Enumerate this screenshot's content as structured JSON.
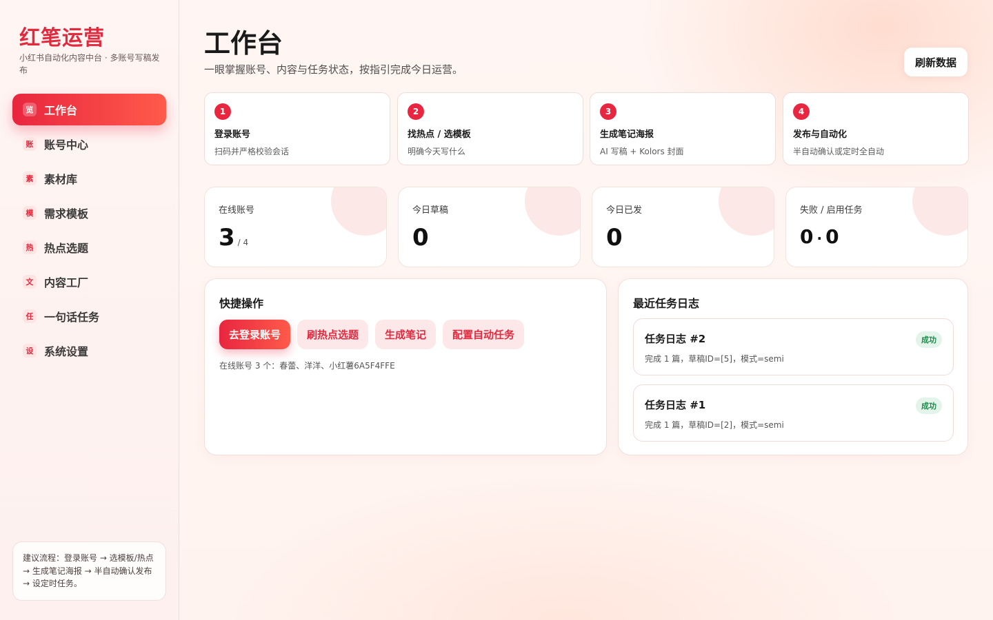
{
  "brand": {
    "title": "红笔运营",
    "subtitle": "小红书自动化内容中台 · 多账号写稿发布"
  },
  "sidebar": {
    "items": [
      {
        "icon_char": "览",
        "icon": "overview-icon",
        "label": "工作台",
        "active": true
      },
      {
        "icon_char": "账",
        "icon": "account-icon",
        "label": "账号中心",
        "active": false
      },
      {
        "icon_char": "素",
        "icon": "material-icon",
        "label": "素材库",
        "active": false
      },
      {
        "icon_char": "模",
        "icon": "template-icon",
        "label": "需求模板",
        "active": false
      },
      {
        "icon_char": "热",
        "icon": "hot-icon",
        "label": "热点选题",
        "active": false
      },
      {
        "icon_char": "文",
        "icon": "content-icon",
        "label": "内容工厂",
        "active": false
      },
      {
        "icon_char": "任",
        "icon": "task-icon",
        "label": "一句话任务",
        "active": false
      },
      {
        "icon_char": "设",
        "icon": "settings-icon",
        "label": "系统设置",
        "active": false
      }
    ],
    "flow_hint": "建议流程：登录账号 → 选模板/热点 → 生成笔记海报 → 半自动确认发布 → 设定时任务。"
  },
  "header": {
    "title": "工作台",
    "subtitle": "一眼掌握账号、内容与任务状态，按指引完成今日运营。",
    "refresh_label": "刷新数据"
  },
  "steps": [
    {
      "num": "1",
      "title": "登录账号",
      "desc": "扫码并严格校验会话"
    },
    {
      "num": "2",
      "title": "找热点 / 选模板",
      "desc": "明确今天写什么"
    },
    {
      "num": "3",
      "title": "生成笔记海报",
      "desc": "AI 写稿 + Kolors 封面"
    },
    {
      "num": "4",
      "title": "发布与自动化",
      "desc": "半自动确认或定时全自动"
    }
  ],
  "stats": {
    "online": {
      "label": "在线账号",
      "value": "3",
      "total": "/ 4"
    },
    "drafts": {
      "label": "今日草稿",
      "value": "0"
    },
    "published": {
      "label": "今日已发",
      "value": "0"
    },
    "tasks": {
      "label": "失败 / 启用任务",
      "failed": "0",
      "sep": "·",
      "enabled": "0"
    }
  },
  "quick": {
    "title": "快捷操作",
    "actions": [
      "去登录账号",
      "刷热点选题",
      "生成笔记",
      "配置自动任务"
    ],
    "online_line": "在线账号 3 个：春蕾、洋洋、小红薯6A5F4FFE"
  },
  "logs": {
    "title": "最近任务日志",
    "items": [
      {
        "title": "任务日志 #2",
        "desc": "完成 1 篇，草稿ID=[5]，模式=semi",
        "status": "成功"
      },
      {
        "title": "任务日志 #1",
        "desc": "完成 1 篇，草稿ID=[2]，模式=semi",
        "status": "成功"
      }
    ]
  },
  "colors": {
    "accent": "#e8263f",
    "accent_light": "#fde8e9",
    "success_bg": "#e3f5ea",
    "success_text": "#1f8a4c"
  }
}
